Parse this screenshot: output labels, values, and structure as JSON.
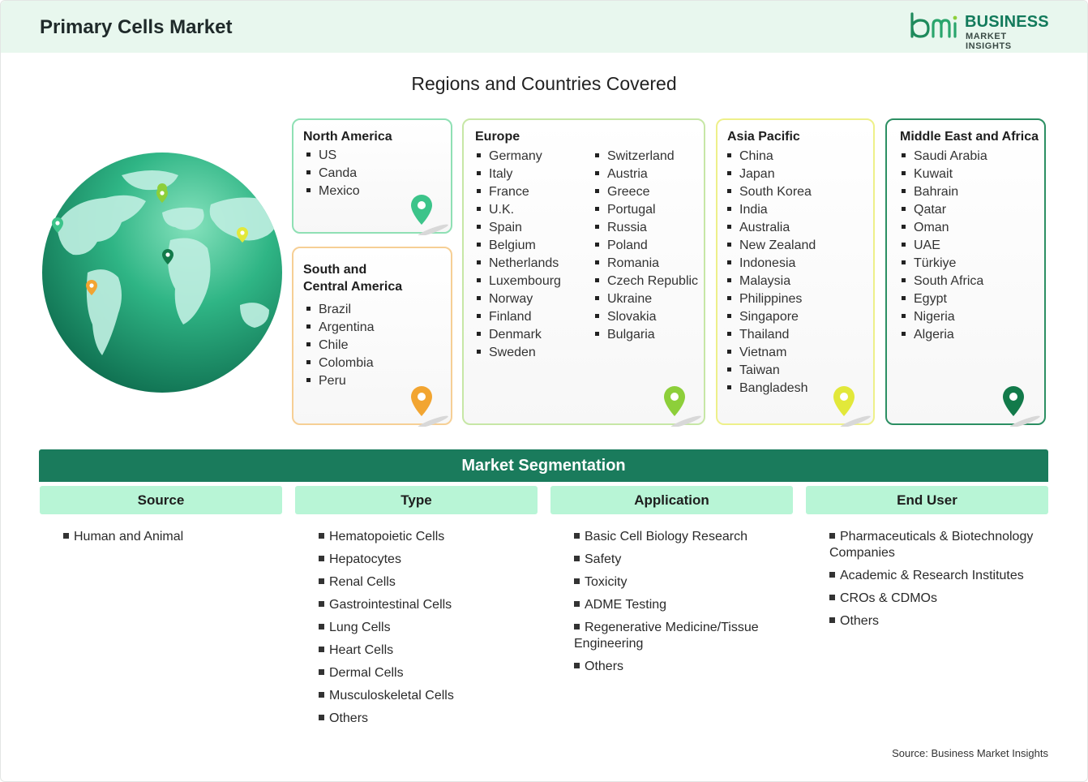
{
  "header": {
    "title": "Primary Cells Market"
  },
  "logo": {
    "line1": "BUSINESS",
    "line2": "MARKET INSIGHTS",
    "mark": "bmi"
  },
  "regions_title": "Regions and Countries Covered",
  "regions": {
    "north_america": {
      "title": "North America",
      "countries": [
        "US",
        "Canda",
        "Mexico"
      ],
      "pin_color": "#3cc48a"
    },
    "south_central_america": {
      "title_line1": "South and",
      "title_line2": "Central America",
      "countries": [
        "Brazil",
        "Argentina",
        "Chile",
        "Colombia",
        "Peru"
      ],
      "pin_color": "#f2a531"
    },
    "europe": {
      "title": "Europe",
      "countries_col1": [
        "Germany",
        "Italy",
        "France",
        "U.K.",
        "Spain",
        "Belgium",
        "Netherlands",
        "Luxembourg",
        "Norway",
        "Finland",
        "Denmark",
        "Sweden"
      ],
      "countries_col2": [
        "Switzerland",
        "Austria",
        "Greece",
        "Portugal",
        "Russia",
        "Poland",
        "Romania",
        "Czech Republic",
        "Ukraine",
        "Slovakia",
        "Bulgaria"
      ],
      "pin_color": "#8dcf3a"
    },
    "asia_pacific": {
      "title": "Asia Pacific",
      "countries": [
        "China",
        "Japan",
        "South Korea",
        "India",
        "Australia",
        "New Zealand",
        "Indonesia",
        "Malaysia",
        "Philippines",
        "Singapore",
        "Thailand",
        "Vietnam",
        "Taiwan",
        "Bangladesh"
      ],
      "pin_color": "#e2e83a"
    },
    "mea": {
      "title": "Middle East and Africa",
      "countries": [
        "Saudi Arabia",
        "Kuwait",
        "Bahrain",
        "Qatar",
        "Oman",
        "UAE",
        "Türkiye",
        "South Africa",
        "Egypt",
        "Nigeria",
        "Algeria"
      ],
      "pin_color": "#127a4a"
    }
  },
  "segmentation": {
    "title": "Market Segmentation",
    "columns": [
      {
        "header": "Source",
        "items": [
          "Human and Animal"
        ]
      },
      {
        "header": "Type",
        "items": [
          "Hematopoietic Cells",
          "Hepatocytes",
          "Renal Cells",
          "Gastrointestinal Cells",
          "Lung Cells",
          "Heart Cells",
          "Dermal Cells",
          "Musculoskeletal Cells",
          "Others"
        ]
      },
      {
        "header": "Application",
        "items": [
          "Basic Cell Biology Research",
          "Safety",
          "Toxicity",
          "ADME Testing",
          "Regenerative Medicine/Tissue Engineering",
          "Others"
        ]
      },
      {
        "header": "End User",
        "items": [
          "Pharmaceuticals & Biotechnology Companies",
          "Academic & Research Institutes",
          "CROs & CDMOs",
          "Others"
        ]
      }
    ]
  },
  "footer": {
    "source": "Source: Business Market Insights"
  }
}
